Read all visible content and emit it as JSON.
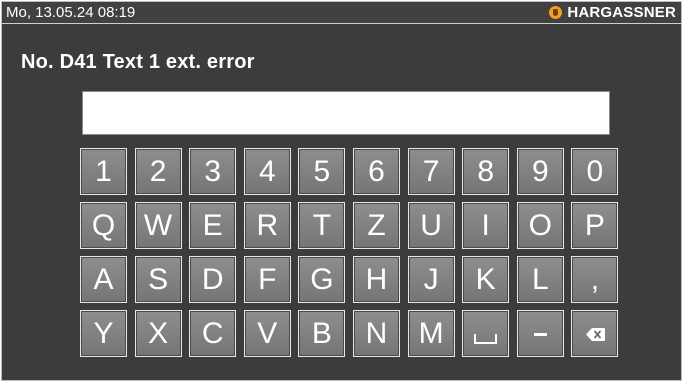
{
  "status_bar": {
    "datetime": "Mo, 13.05.24 08:19",
    "brand": "HARGASSNER",
    "brand_icon": "hargassner-flame-icon"
  },
  "dialog": {
    "title": "No. D41 Text 1 ext. error",
    "input_value": ""
  },
  "keyboard": {
    "rows": [
      [
        "1",
        "2",
        "3",
        "4",
        "5",
        "6",
        "7",
        "8",
        "9",
        "0"
      ],
      [
        "Q",
        "W",
        "E",
        "R",
        "T",
        "Z",
        "U",
        "I",
        "O",
        "P"
      ],
      [
        "A",
        "S",
        "D",
        "F",
        "G",
        "H",
        "J",
        "K",
        "L",
        ","
      ],
      [
        "Y",
        "X",
        "C",
        "V",
        "B",
        "N",
        "M",
        "space",
        "-",
        "backspace"
      ]
    ]
  },
  "colors": {
    "background": "#3c3c3c",
    "key_face": "#808080",
    "key_border": "#e8e8e8",
    "text": "#ffffff",
    "brand_logo": "#f0a020"
  }
}
